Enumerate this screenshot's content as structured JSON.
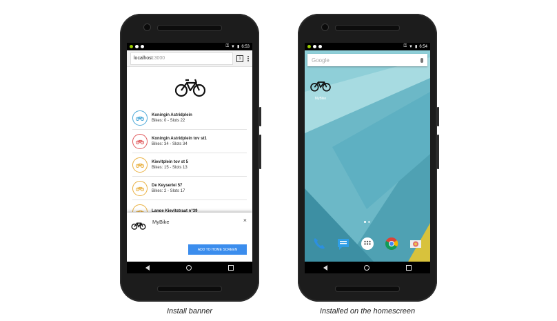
{
  "left_phone": {
    "status": {
      "time": "6:53"
    },
    "browser": {
      "url_host": "localhost",
      "url_port": ":3000",
      "tab_count": "1"
    },
    "stations": [
      {
        "name": "Koningin Astridplein",
        "detail": "Bikes: 0 - Slots 22",
        "color": "#4aa8d8"
      },
      {
        "name": "Koningin Astridplein tov st1",
        "detail": "Bikes: 34 - Slots 34",
        "color": "#e0595c"
      },
      {
        "name": "Kievitplein tov st 5",
        "detail": "Bikes: 15 - Slots 13",
        "color": "#e9b040"
      },
      {
        "name": "De Keyserlei 57",
        "detail": "Bikes: 2 - Slots 17",
        "color": "#e9b040"
      },
      {
        "name": "Lange Kievitstraat n°39",
        "detail": "",
        "color": "#e9b040"
      }
    ],
    "banner": {
      "app_name": "MyBike",
      "close": "×",
      "add_button": "ADD TO HOME SCREEN"
    }
  },
  "right_phone": {
    "status": {
      "time": "6:54"
    },
    "search": {
      "placeholder": "Google"
    },
    "app": {
      "label": "MyBike"
    },
    "dock_icons": [
      "phone-icon",
      "messages-icon",
      "app-drawer-icon",
      "chrome-icon",
      "camera-icon"
    ]
  },
  "captions": {
    "left": "Install banner",
    "right": "Installed on the homescreen"
  }
}
